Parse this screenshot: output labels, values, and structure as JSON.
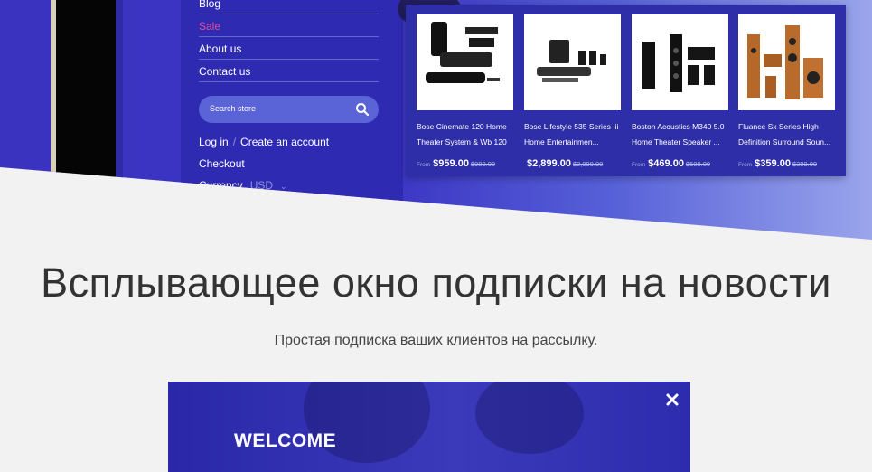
{
  "menu": {
    "links": [
      {
        "label": "Blog"
      },
      {
        "label": "Sale"
      },
      {
        "label": "About us"
      },
      {
        "label": "Contact us"
      }
    ],
    "search_placeholder": "Search store",
    "login_label": "Log in",
    "login_separator": "/",
    "create_account_label": "Create an account",
    "checkout_label": "Checkout",
    "currency_label": "Currency",
    "currency_value": "USD"
  },
  "products": [
    {
      "title": "Bose Cinemate 120 Home Theater System & Wb 120 ...",
      "from": "From",
      "price": "$959.00",
      "old_price": "$989.00"
    },
    {
      "title": "Bose Lifestyle 535 Series Iii Home Entertainmen...",
      "from": "",
      "price": "$2,899.00",
      "old_price": "$2,999.00"
    },
    {
      "title": "Boston Acoustics M340 5.0 Home Theater Speaker ...",
      "from": "From",
      "price": "$469.00",
      "old_price": "$509.00"
    },
    {
      "title": "Fluance Sx Series High Definition Surround Soun...",
      "from": "From",
      "price": "$359.00",
      "old_price": "$389.00"
    }
  ],
  "section": {
    "heading": "Всплывающее окно подписки на новости",
    "subheading": "Простая подписка ваших клиентов на рассылку."
  },
  "popup": {
    "title": "WELCOME",
    "close_icon": "close-icon"
  },
  "colors": {
    "accent": "#3a33c0",
    "sale": "#e84aa0",
    "product_panel": "#2e2ea8"
  }
}
